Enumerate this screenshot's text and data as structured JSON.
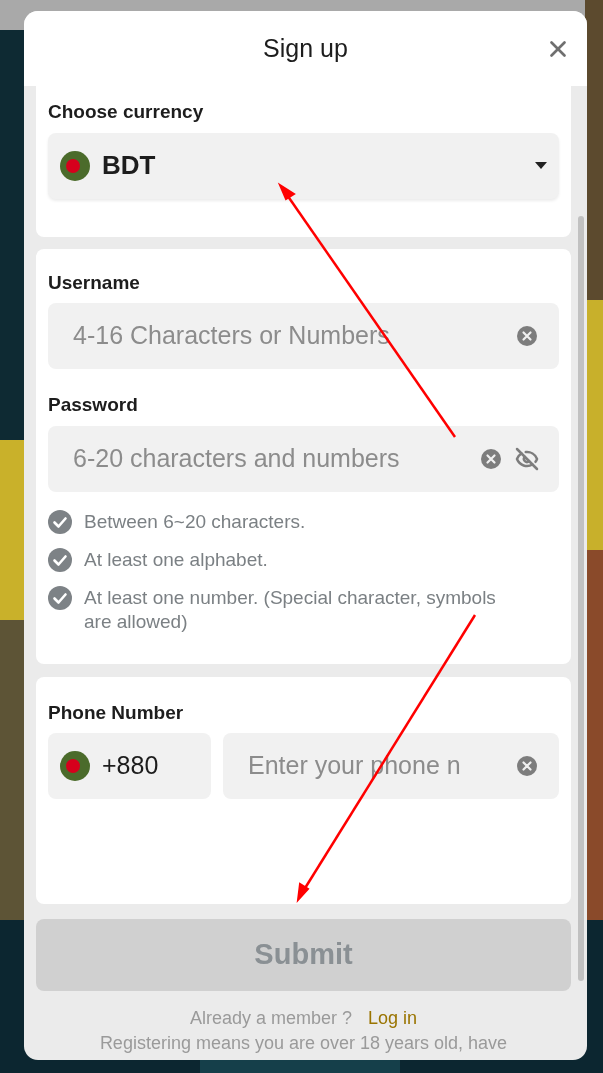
{
  "dialog": {
    "title": "Sign up"
  },
  "currency": {
    "label": "Choose currency",
    "value": "BDT"
  },
  "username": {
    "label": "Username",
    "placeholder": "4-16 Characters or Numbers"
  },
  "password": {
    "label": "Password",
    "placeholder": "6-20 characters and numbers",
    "rules": [
      {
        "text": "Between 6~20 characters.",
        "met": false
      },
      {
        "text": "At least one alphabet.",
        "met": false
      },
      {
        "text": "At least one number. (Special character, symbols are allowed)",
        "met": false
      }
    ]
  },
  "phone": {
    "label": "Phone Number",
    "code": "+880",
    "placeholder": "Enter your phone n"
  },
  "submit": {
    "label": "Submit",
    "disabled": true
  },
  "footer": {
    "prompt": "Already a member ?",
    "link": "Log in",
    "notice": "Registering means you are over 18 years old, have"
  }
}
